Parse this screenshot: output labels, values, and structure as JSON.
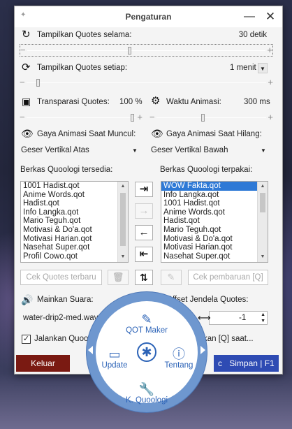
{
  "window": {
    "title": "Pengaturan",
    "minimize": "—",
    "close": "✕"
  },
  "quotes_duration": {
    "label": "Tampilkan Quotes selama:",
    "value": "30 detik",
    "level": 0.43
  },
  "quotes_interval": {
    "label": "Tampilkan Quotes setiap:",
    "value": "1 menit",
    "level": 0.04
  },
  "transparency": {
    "label": "Transparasi Quotes:",
    "value": "100 %",
    "level": 1.0
  },
  "anim_time": {
    "label": "Waktu Animasi:",
    "value": "300 ms",
    "level": 0.42
  },
  "anim_show": {
    "label": "Gaya Animasi Saat Muncul:",
    "value": "Geser Vertikal Atas"
  },
  "anim_hide": {
    "label": "Gaya Animasi Saat Hilang:",
    "value": "Geser Vertikal Bawah"
  },
  "available": {
    "label": "Berkas Quoologi tersedia:",
    "items": [
      "1001 Hadist.qot",
      "Anime Words.qot",
      "Hadist.qot",
      "Info Langka.qot",
      "Mario Teguh.qot",
      "Motivasi & Do'a.qot",
      "Motivasi Harian.qot",
      "Nasehat Super.qot",
      "Profil Cowo.qot"
    ]
  },
  "used": {
    "label": "Berkas Quoologi terpakai:",
    "items": [
      "WOW Fakta.qot",
      "Info Langka.qot",
      "1001 Hadist.qot",
      "Anime Words.qot",
      "Hadist.qot",
      "Mario Teguh.qot",
      "Motivasi & Do'a.qot",
      "Motivasi Harian.qot",
      "Nasehat Super.qot"
    ],
    "selected_index": 0
  },
  "buttons": {
    "check_quotes": "Cek Quotes terbaru",
    "check_update": "Cek pembaruan [Q]",
    "keluar": "Keluar",
    "simpan": "Simpan | F1"
  },
  "sound": {
    "label": "Mainkan Suara:",
    "file": "water-drip2-med.wav"
  },
  "offset": {
    "label": "Offset Jendela Quotes:",
    "y": "0",
    "x": "-1"
  },
  "run_label": "Jalankan Quool",
  "press_label": "kan [Q] saat...",
  "radial_menu": {
    "top": "QOT Maker",
    "left": "Update",
    "right": "Tentang",
    "bottom": "K. Quoologi"
  },
  "colors": {
    "accent": "#2c63b7",
    "ring": "#6e97cf",
    "keluar": "#7a1a12",
    "simpan": "#2e4bb3"
  }
}
